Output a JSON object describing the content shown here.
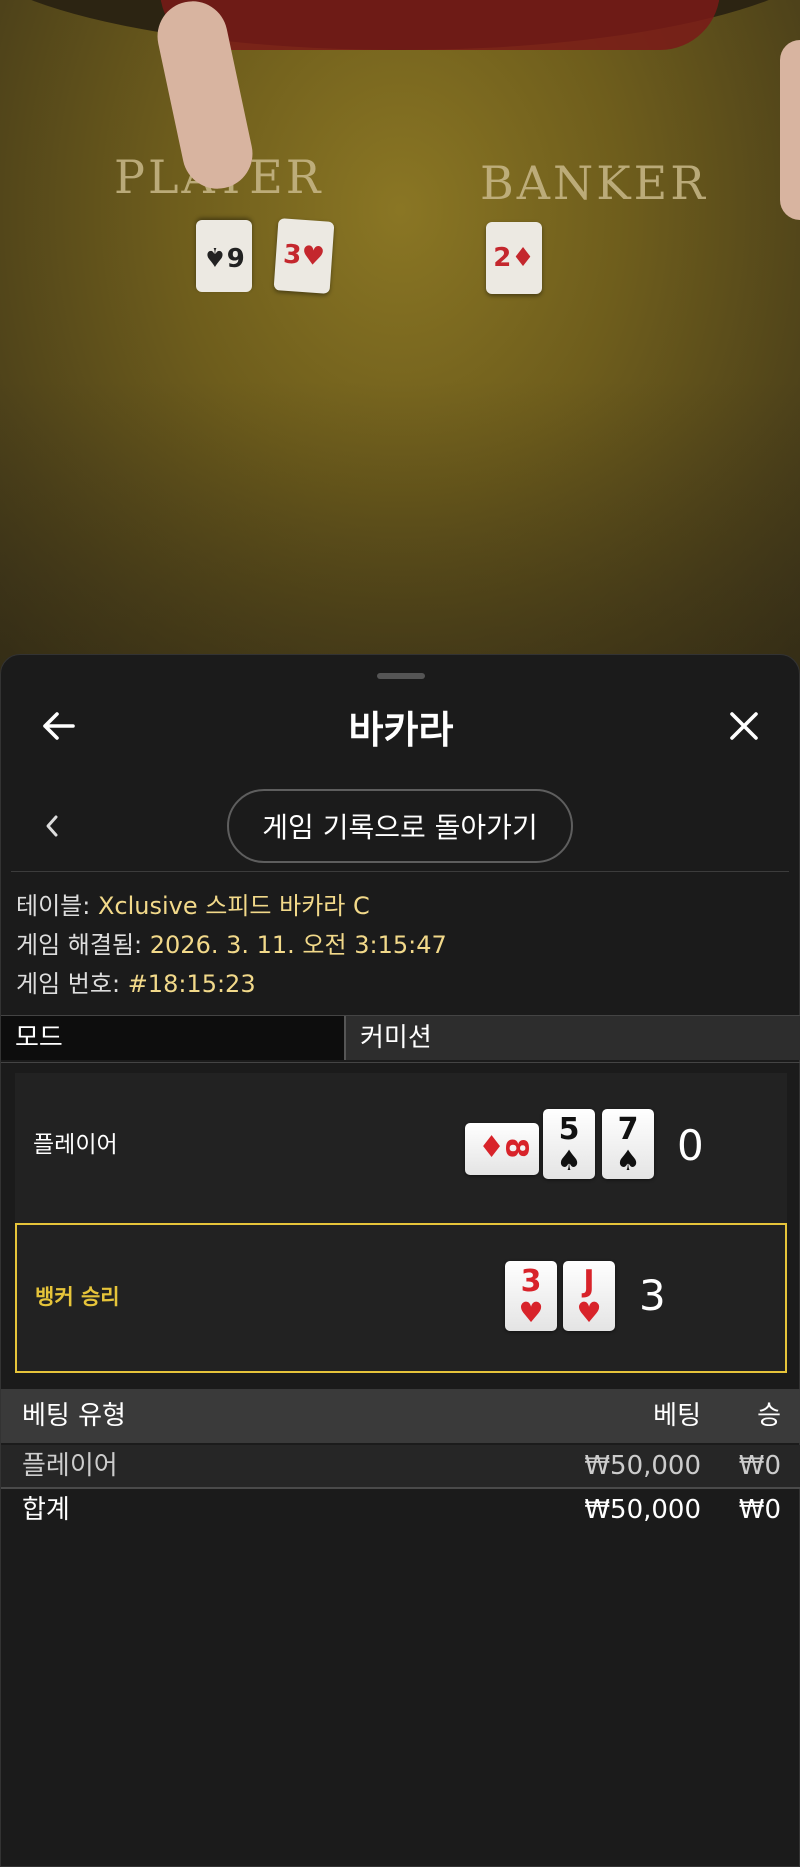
{
  "video": {
    "player_zone_label": "PLAYER",
    "banker_zone_label": "BANKER"
  },
  "header": {
    "title": "바카라",
    "back_icon": "arrow-left-icon",
    "close_icon": "close-icon"
  },
  "nav": {
    "back_to_history_label": "게임 기록으로 돌아가기",
    "prev_icon": "chevron-left-icon"
  },
  "info": {
    "table_label": "테이블:",
    "table_value": "Xclusive 스피드 바카라 C",
    "resolved_label": "게임 해결됨:",
    "resolved_value": "2026. 3. 11. 오전 3:15:47",
    "game_number_label": "게임 번호:",
    "game_number_value": "#18:15:23"
  },
  "tabs": {
    "mode": "모드",
    "commission": "커미션"
  },
  "hands": {
    "player": {
      "label": "플레이어",
      "score": "0",
      "cards": [
        {
          "rank": "8",
          "suit": "♦",
          "color": "red",
          "orientation": "sideways"
        },
        {
          "rank": "5",
          "suit": "♠",
          "color": "black"
        },
        {
          "rank": "7",
          "suit": "♠",
          "color": "black"
        }
      ]
    },
    "banker": {
      "label": "뱅커 승리",
      "score": "3",
      "cards": [
        {
          "rank": "3",
          "suit": "♥",
          "color": "red"
        },
        {
          "rank": "J",
          "suit": "♥",
          "color": "red"
        }
      ],
      "highlight_color": "#e6c43a"
    }
  },
  "bets": {
    "columns": {
      "type": "베팅 유형",
      "bet": "베팅",
      "win": "승"
    },
    "rows": [
      {
        "type": "플레이어",
        "bet": "₩50,000",
        "win": "₩0"
      }
    ],
    "total": {
      "type": "합계",
      "bet": "₩50,000",
      "win": "₩0"
    }
  }
}
